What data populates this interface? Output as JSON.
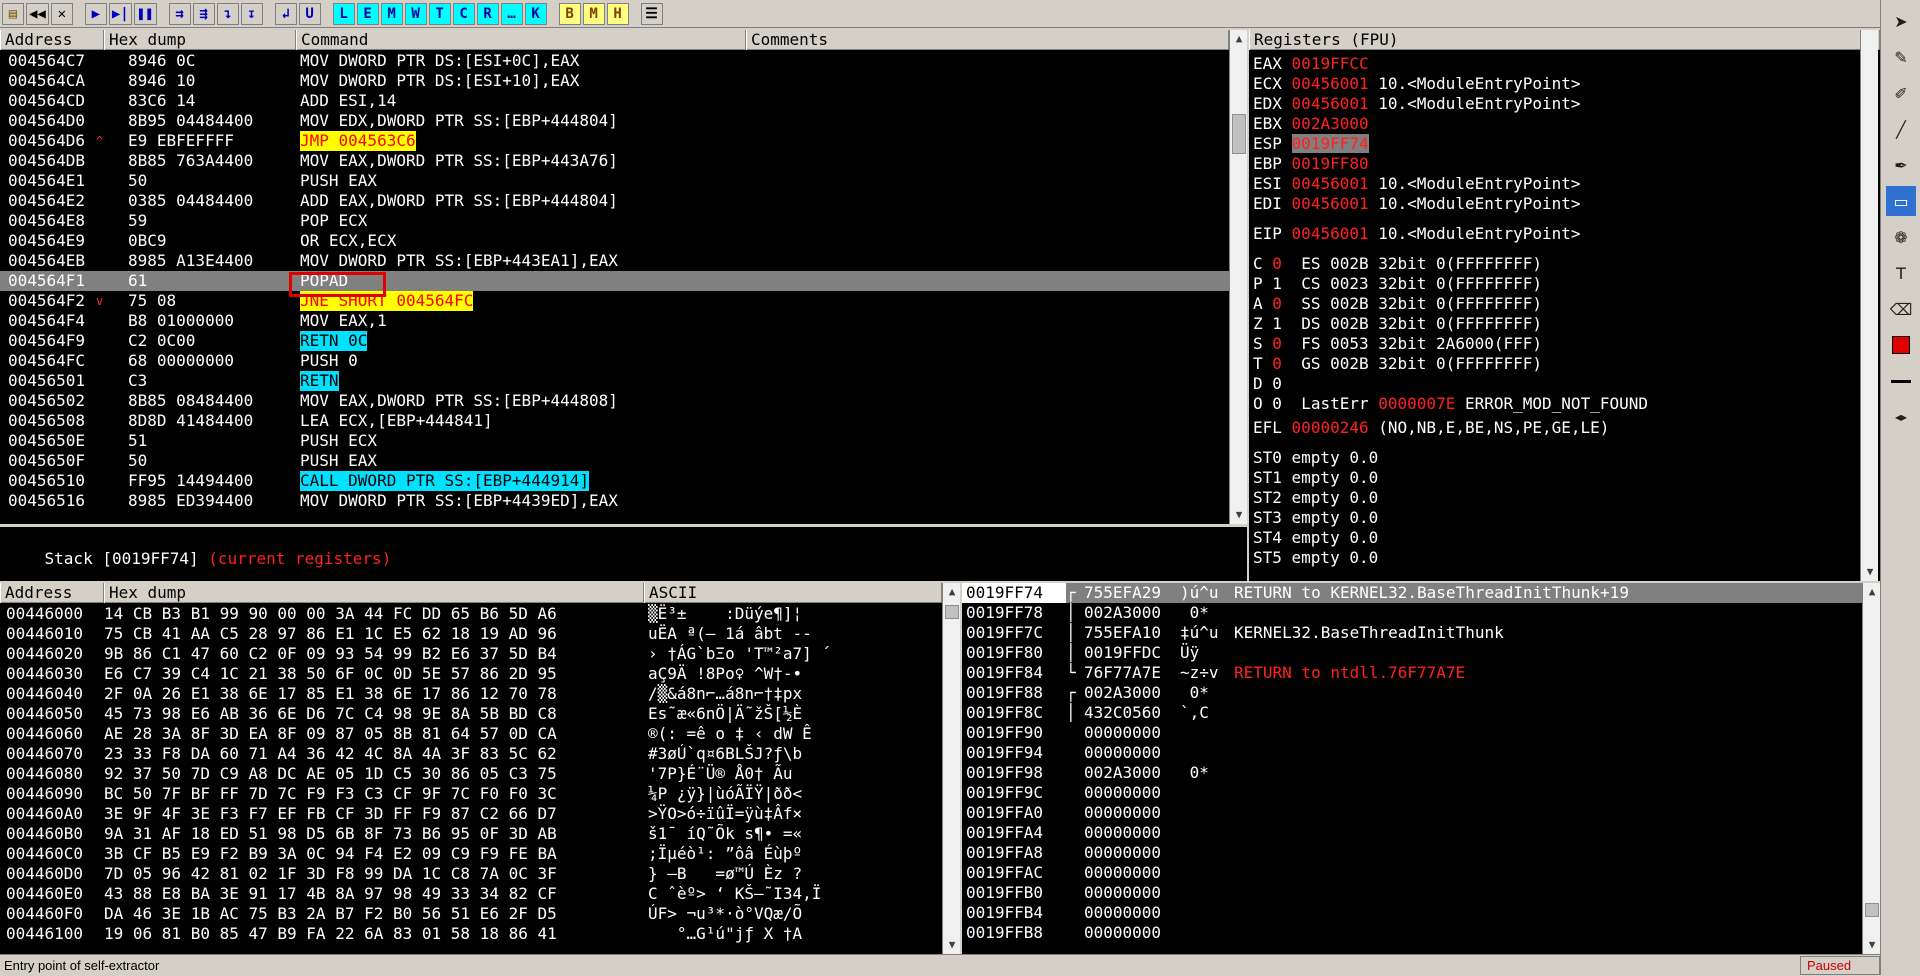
{
  "toolbar": {
    "buttons": [
      "open",
      "rewind",
      "close",
      "run",
      "step-into",
      "pause",
      "trace-into",
      "trace-over",
      "execute-till",
      "breakpoint",
      "go-to",
      "execute-till-user",
      "L",
      "E",
      "M",
      "W",
      "T",
      "C",
      "R",
      "…",
      "K",
      "B",
      "M",
      "H",
      "list"
    ]
  },
  "disasm": {
    "headers": [
      "Address",
      "Hex dump",
      "Command",
      "Comments"
    ],
    "rows": [
      {
        "addr": "004564C7",
        "hex": "8946 0C",
        "cmd": "MOV DWORD PTR DS:[ESI+0C],EAX",
        "mark": "",
        "style": ""
      },
      {
        "addr": "004564CA",
        "hex": "8946 10",
        "cmd": "MOV DWORD PTR DS:[ESI+10],EAX",
        "mark": "",
        "style": ""
      },
      {
        "addr": "004564CD",
        "hex": "83C6 14",
        "cmd": "ADD ESI,14",
        "mark": "",
        "style": ""
      },
      {
        "addr": "004564D0",
        "hex": "8B95 04484400",
        "cmd": "MOV EDX,DWORD PTR SS:[EBP+444804]",
        "mark": "",
        "style": ""
      },
      {
        "addr": "004564D6",
        "hex": "E9 EBFEFFFF",
        "cmd": "JMP 004563C6",
        "mark": "^",
        "style": "y"
      },
      {
        "addr": "004564DB",
        "hex": "8B85 763A4400",
        "cmd": "MOV EAX,DWORD PTR SS:[EBP+443A76]",
        "mark": "",
        "style": ""
      },
      {
        "addr": "004564E1",
        "hex": "50",
        "cmd": "PUSH EAX",
        "mark": "",
        "style": ""
      },
      {
        "addr": "004564E2",
        "hex": "0385 04484400",
        "cmd": "ADD EAX,DWORD PTR SS:[EBP+444804]",
        "mark": "",
        "style": ""
      },
      {
        "addr": "004564E8",
        "hex": "59",
        "cmd": "POP ECX",
        "mark": "",
        "style": ""
      },
      {
        "addr": "004564E9",
        "hex": "0BC9",
        "cmd": "OR ECX,ECX",
        "mark": "",
        "style": ""
      },
      {
        "addr": "004564EB",
        "hex": "8985 A13E4400",
        "cmd": "MOV DWORD PTR SS:[EBP+443EA1],EAX",
        "mark": "",
        "style": ""
      },
      {
        "addr": "004564F1",
        "hex": "61",
        "cmd": "POPAD",
        "mark": "",
        "style": "sel"
      },
      {
        "addr": "004564F2",
        "hex": "75 08",
        "cmd": "JNE SHORT 004564FC",
        "mark": "v",
        "style": "y"
      },
      {
        "addr": "004564F4",
        "hex": "B8 01000000",
        "cmd": "MOV EAX,1",
        "mark": "",
        "style": ""
      },
      {
        "addr": "004564F9",
        "hex": "C2 0C00",
        "cmd": "RETN 0C",
        "mark": "",
        "style": "c"
      },
      {
        "addr": "004564FC",
        "hex": "68 00000000",
        "cmd": "PUSH 0",
        "mark": "",
        "style": ""
      },
      {
        "addr": "00456501",
        "hex": "C3",
        "cmd": "RETN",
        "mark": "",
        "style": "c"
      },
      {
        "addr": "00456502",
        "hex": "8B85 08484400",
        "cmd": "MOV EAX,DWORD PTR SS:[EBP+444808]",
        "mark": "",
        "style": ""
      },
      {
        "addr": "00456508",
        "hex": "8D8D 41484400",
        "cmd": "LEA ECX,[EBP+444841]",
        "mark": "",
        "style": ""
      },
      {
        "addr": "0045650E",
        "hex": "51",
        "cmd": "PUSH ECX",
        "mark": "",
        "style": ""
      },
      {
        "addr": "0045650F",
        "hex": "50",
        "cmd": "PUSH EAX",
        "mark": "",
        "style": ""
      },
      {
        "addr": "00456510",
        "hex": "FF95 14494400",
        "cmd": "CALL DWORD PTR SS:[EBP+444914]",
        "mark": "",
        "style": "c"
      },
      {
        "addr": "00456516",
        "hex": "8985 ED394400",
        "cmd": "MOV DWORD PTR SS:[EBP+4439ED],EAX",
        "mark": "",
        "style": ""
      }
    ]
  },
  "info": {
    "prefix": "Stack [0019FF74]",
    "note": "(current registers)"
  },
  "registers": {
    "title": "Registers (FPU)",
    "gp": [
      {
        "name": "EAX",
        "val": "0019FFCC",
        "extra": "",
        "hl": false
      },
      {
        "name": "ECX",
        "val": "00456001",
        "extra": "10.<ModuleEntryPoint>",
        "hl": false
      },
      {
        "name": "EDX",
        "val": "00456001",
        "extra": "10.<ModuleEntryPoint>",
        "hl": false
      },
      {
        "name": "EBX",
        "val": "002A3000",
        "extra": "",
        "hl": false
      },
      {
        "name": "ESP",
        "val": "0019FF74",
        "extra": "",
        "hl": true
      },
      {
        "name": "EBP",
        "val": "0019FF80",
        "extra": "",
        "hl": false
      },
      {
        "name": "ESI",
        "val": "00456001",
        "extra": "10.<ModuleEntryPoint>",
        "hl": false
      },
      {
        "name": "EDI",
        "val": "00456001",
        "extra": "10.<ModuleEntryPoint>",
        "hl": false
      }
    ],
    "eip": {
      "name": "EIP",
      "val": "00456001",
      "extra": "10.<ModuleEntryPoint>"
    },
    "flags": [
      {
        "f": "C",
        "v": "0",
        "seg": "ES 002B 32bit 0(FFFFFFFF)"
      },
      {
        "f": "P",
        "v": "1",
        "seg": "CS 0023 32bit 0(FFFFFFFF)"
      },
      {
        "f": "A",
        "v": "0",
        "seg": "SS 002B 32bit 0(FFFFFFFF)"
      },
      {
        "f": "Z",
        "v": "1",
        "seg": "DS 002B 32bit 0(FFFFFFFF)"
      },
      {
        "f": "S",
        "v": "0",
        "seg": "FS 0053 32bit 2A6000(FFF)"
      },
      {
        "f": "T",
        "v": "0",
        "seg": "GS 002B 32bit 0(FFFFFFFF)"
      },
      {
        "f": "D",
        "v": "0",
        "seg": ""
      },
      {
        "f": "O",
        "v": "0",
        "seg": ""
      }
    ],
    "lasterr": {
      "label": "LastErr",
      "val": "0000007E",
      "text": "ERROR_MOD_NOT_FOUND"
    },
    "efl": {
      "label": "EFL",
      "val": "00000246",
      "text": "(NO,NB,E,BE,NS,PE,GE,LE)"
    },
    "fpu": [
      "ST0 empty 0.0",
      "ST1 empty 0.0",
      "ST2 empty 0.0",
      "ST3 empty 0.0",
      "ST4 empty 0.0",
      "ST5 empty 0.0"
    ]
  },
  "dump": {
    "headers": [
      "Address",
      "Hex dump",
      "ASCII"
    ],
    "rows": [
      {
        "addr": "00446000",
        "hex": "14 CB B3 B1 99 90 00 00 3A 44 FC DD 65 B6 5D A6",
        "ascii": "▒Ë³±    :Düýe¶]¦"
      },
      {
        "addr": "00446010",
        "hex": "75 CB 41 AA C5 28 97 86 E1 1C E5 62 18 19 AD 96",
        "ascii": "uËA ª(— 1á âbt ‐‑"
      },
      {
        "addr": "00446020",
        "hex": "9B 86 C1 47 60 C2 0F 09 93 54 99 B2 E6 37 5D B4",
        "ascii": "› †ÁG`bΞo 'T™²a7] ´"
      },
      {
        "addr": "00446030",
        "hex": "E6 C7 39 C4 1C 21 38 50 6F 0C 0D 5E 57 86 2D 95",
        "ascii": "aÇ9Ä !8Po♀ ^W†-•"
      },
      {
        "addr": "00446040",
        "hex": "2F 0A 26 E1 38 6E 17 85 E1 38 6E 17 86 12 70 78",
        "ascii": "/▒&á8n⌐…á8n⌐†‡px"
      },
      {
        "addr": "00446050",
        "hex": "45 73 98 E6 AB 36 6E D6 7C C4 98 9E 8A 5B BD C8",
        "ascii": "Es˜æ«6nÖ|Ä˜žŠ[½È"
      },
      {
        "addr": "00446060",
        "hex": "AE 28 3A 8F 3D EA 8F 09 87 05 8B 81 64 57 0D CA",
        "ascii": "®(: =ê o ‡ ‹ dW Ê"
      },
      {
        "addr": "00446070",
        "hex": "23 33 F8 DA 60 71 A4 36 42 4C 8A 4A 3F 83 5C 62",
        "ascii": "#3øÚ`q¤6BLŠJ?ƒ\\b"
      },
      {
        "addr": "00446080",
        "hex": "92 37 50 7D C9 A8 DC AE 05 1D C5 30 86 05 C3 75",
        "ascii": "'7P}É¨Ü® Å0† Ãu"
      },
      {
        "addr": "00446090",
        "hex": "BC 50 7F BF FF 7D 7C F9 F3 C3 CF 9F 7C F0 F0 3C",
        "ascii": "¼P ¿ÿ}|ùóÃÏŸ|ðð<"
      },
      {
        "addr": "004460A0",
        "hex": "3E 9F 4F 3E F3 F7 EF FB CF 3D FF F9 87 C2 66 D7",
        "ascii": ">ŸO>ó÷ïûÏ=ÿù‡Âf×"
      },
      {
        "addr": "004460B0",
        "hex": "9A 31 AF 18 ED 51 98 D5 6B 8F 73 B6 95 0F 3D AB",
        "ascii": "š1¯ íQ˜Õk s¶• =«"
      },
      {
        "addr": "004460C0",
        "hex": "3B CF B5 E9 F2 B9 3A 0C 94 F4 E2 09 C9 F9 FE BA",
        "ascii": ";Ïµéò¹: ”ôâ Éùþº"
      },
      {
        "addr": "004460D0",
        "hex": "7D 05 96 42 81 02 1F 3D F8 99 DA 1C C8 7A 0C 3F",
        "ascii": "} –B   =ø™Ú Èz ?"
      },
      {
        "addr": "004460E0",
        "hex": "43 88 E8 BA 3E 91 17 4B 8A 97 98 49 33 34 82 CF",
        "ascii": "C ˆèº> ‘ KŠ—˜I34‚Ï"
      },
      {
        "addr": "004460F0",
        "hex": "DA 46 3E 1B AC 75 B3 2A B7 F2 B0 56 51 E6 2F D5",
        "ascii": "ÚF> ¬u³*·ò°VQæ/Õ"
      },
      {
        "addr": "00446100",
        "hex": "19 06 81 B0 85 47 B9 FA 22 6A 83 01 58 18 86 41",
        "ascii": "   °…G¹ú\"jƒ X †A"
      }
    ]
  },
  "stack": {
    "rows": [
      {
        "addr": "0019FF74",
        "val": "755EFA29",
        "ascii": ")ú^u",
        "comment": "RETURN to KERNEL32.BaseThreadInitThunk+19",
        "sel": true,
        "cstyle": "w",
        "br": "top"
      },
      {
        "addr": "0019FF78",
        "val": "002A3000",
        "ascii": " 0*",
        "comment": "",
        "sel": false,
        "cstyle": "",
        "br": "mid"
      },
      {
        "addr": "0019FF7C",
        "val": "755EFA10",
        "ascii": "‡ú^u",
        "comment": "KERNEL32.BaseThreadInitThunk",
        "sel": false,
        "cstyle": "w",
        "br": "mid"
      },
      {
        "addr": "0019FF80",
        "val": "0019FFDC",
        "ascii": "Üÿ ",
        "comment": "",
        "sel": false,
        "cstyle": "",
        "br": "mid"
      },
      {
        "addr": "0019FF84",
        "val": "76F77A7E",
        "ascii": "~z÷v",
        "comment": "RETURN to ntdll.76F77A7E",
        "sel": false,
        "cstyle": "r",
        "br": "bot"
      },
      {
        "addr": "0019FF88",
        "val": "002A3000",
        "ascii": " 0*",
        "comment": "",
        "sel": false,
        "cstyle": "",
        "br": "top"
      },
      {
        "addr": "0019FF8C",
        "val": "432C0560",
        "ascii": "`,C",
        "comment": "",
        "sel": false,
        "cstyle": "",
        "br": "mid"
      },
      {
        "addr": "0019FF90",
        "val": "00000000",
        "ascii": "",
        "comment": "",
        "sel": false,
        "cstyle": "",
        "br": ""
      },
      {
        "addr": "0019FF94",
        "val": "00000000",
        "ascii": "",
        "comment": "",
        "sel": false,
        "cstyle": "",
        "br": ""
      },
      {
        "addr": "0019FF98",
        "val": "002A3000",
        "ascii": " 0*",
        "comment": "",
        "sel": false,
        "cstyle": "",
        "br": ""
      },
      {
        "addr": "0019FF9C",
        "val": "00000000",
        "ascii": "",
        "comment": "",
        "sel": false,
        "cstyle": "",
        "br": ""
      },
      {
        "addr": "0019FFA0",
        "val": "00000000",
        "ascii": "",
        "comment": "",
        "sel": false,
        "cstyle": "",
        "br": ""
      },
      {
        "addr": "0019FFA4",
        "val": "00000000",
        "ascii": "",
        "comment": "",
        "sel": false,
        "cstyle": "",
        "br": ""
      },
      {
        "addr": "0019FFA8",
        "val": "00000000",
        "ascii": "",
        "comment": "",
        "sel": false,
        "cstyle": "",
        "br": ""
      },
      {
        "addr": "0019FFAC",
        "val": "00000000",
        "ascii": "",
        "comment": "",
        "sel": false,
        "cstyle": "",
        "br": ""
      },
      {
        "addr": "0019FFB0",
        "val": "00000000",
        "ascii": "",
        "comment": "",
        "sel": false,
        "cstyle": "",
        "br": ""
      },
      {
        "addr": "0019FFB4",
        "val": "00000000",
        "ascii": "",
        "comment": "",
        "sel": false,
        "cstyle": "",
        "br": ""
      },
      {
        "addr": "0019FFB8",
        "val": "00000000",
        "ascii": "",
        "comment": "",
        "sel": false,
        "cstyle": "",
        "br": ""
      }
    ]
  },
  "status": {
    "text": "Entry point of self-extractor",
    "state": "Paused"
  },
  "colors": {
    "accent": "#ff2020",
    "yellow": "#ffff00",
    "cyan": "#00e0ff",
    "select": "#808080"
  }
}
